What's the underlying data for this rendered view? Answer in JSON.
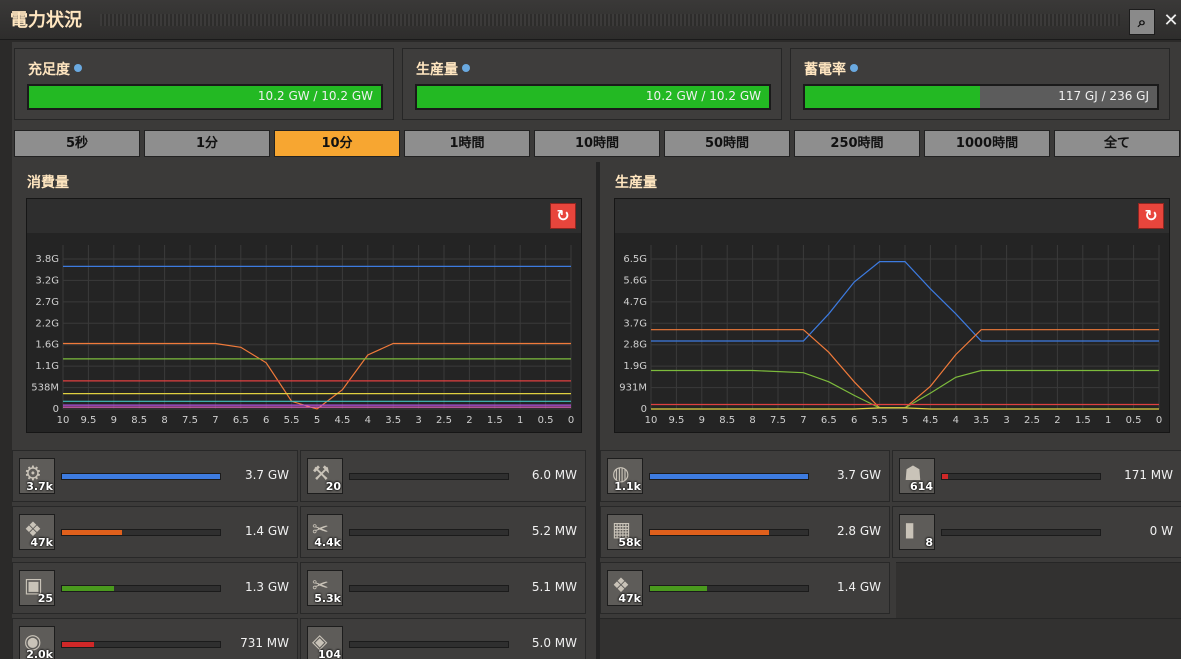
{
  "window": {
    "title": "電力状況"
  },
  "stats": [
    {
      "label": "充足度",
      "value_text": "10.2 GW / 10.2 GW",
      "fill": 1.0
    },
    {
      "label": "生産量",
      "value_text": "10.2 GW / 10.2 GW",
      "fill": 1.0
    },
    {
      "label": "蓄電率",
      "value_text": "117 GJ / 236 GJ",
      "fill": 0.496
    }
  ],
  "tabs": [
    "5秒",
    "1分",
    "10分",
    "1時間",
    "10時間",
    "50時間",
    "250時間",
    "1000時間",
    "全て"
  ],
  "active_tab": 2,
  "colors": {
    "bar_green": "#23b923",
    "tab_active": "#f7a631",
    "reset": "#e8453c"
  },
  "chart_data": [
    {
      "type": "line",
      "title": "消費量",
      "x_ticks": [
        "10",
        "9.5",
        "9",
        "8.5",
        "8",
        "7.5",
        "7",
        "6.5",
        "6",
        "5.5",
        "5",
        "4.5",
        "4",
        "3.5",
        "3",
        "2.5",
        "2",
        "1.5",
        "1",
        "0.5",
        "0"
      ],
      "y_ticks": [
        "0",
        "538M",
        "1.1G",
        "1.6G",
        "2.2G",
        "2.7G",
        "3.2G",
        "3.8G"
      ],
      "x": [
        10,
        9,
        8,
        7,
        6.5,
        6,
        5.5,
        5,
        4.5,
        4,
        3.5,
        3,
        2,
        1,
        0
      ],
      "ylim": [
        0,
        4.0
      ],
      "series": [
        {
          "color": "#3d7be0",
          "values": [
            3.7,
            3.7,
            3.7,
            3.7,
            3.7,
            3.7,
            3.7,
            3.7,
            3.7,
            3.7,
            3.7,
            3.7,
            3.7,
            3.7,
            3.7
          ]
        },
        {
          "color": "#f07a3a",
          "values": [
            1.7,
            1.7,
            1.7,
            1.7,
            1.6,
            1.2,
            0.2,
            0.0,
            0.5,
            1.4,
            1.7,
            1.7,
            1.7,
            1.7,
            1.7
          ]
        },
        {
          "color": "#7dbb3c",
          "values": [
            1.3,
            1.3,
            1.3,
            1.3,
            1.3,
            1.3,
            1.3,
            1.3,
            1.3,
            1.3,
            1.3,
            1.3,
            1.3,
            1.3,
            1.3
          ]
        },
        {
          "color": "#e04040",
          "values": [
            0.73,
            0.73,
            0.73,
            0.73,
            0.73,
            0.73,
            0.73,
            0.73,
            0.73,
            0.73,
            0.73,
            0.73,
            0.73,
            0.73,
            0.73
          ]
        },
        {
          "color": "#e0d040",
          "values": [
            0.4,
            0.4,
            0.4,
            0.4,
            0.4,
            0.4,
            0.4,
            0.4,
            0.4,
            0.4,
            0.4,
            0.4,
            0.4,
            0.4,
            0.4
          ]
        },
        {
          "color": "#b050e0",
          "values": [
            0.1,
            0.1,
            0.1,
            0.1,
            0.1,
            0.1,
            0.1,
            0.1,
            0.1,
            0.1,
            0.1,
            0.1,
            0.1,
            0.1,
            0.1
          ]
        },
        {
          "color": "#e060c0",
          "values": [
            0.05,
            0.05,
            0.05,
            0.05,
            0.05,
            0.05,
            0.05,
            0.05,
            0.05,
            0.05,
            0.05,
            0.05,
            0.05,
            0.05,
            0.05
          ]
        },
        {
          "color": "#40c0c0",
          "values": [
            0.2,
            0.2,
            0.2,
            0.2,
            0.2,
            0.2,
            0.2,
            0.2,
            0.2,
            0.2,
            0.2,
            0.2,
            0.2,
            0.2,
            0.2
          ]
        }
      ]
    },
    {
      "type": "line",
      "title": "生産量",
      "x_ticks": [
        "10",
        "9.5",
        "9",
        "8.5",
        "8",
        "7.5",
        "7",
        "6.5",
        "6",
        "5.5",
        "5",
        "4.5",
        "4",
        "3.5",
        "3",
        "2.5",
        "2",
        "1.5",
        "1",
        "0.5",
        "0"
      ],
      "y_ticks": [
        "0",
        "931M",
        "1.9G",
        "2.8G",
        "3.7G",
        "4.7G",
        "5.6G",
        "6.5G"
      ],
      "x": [
        10,
        9,
        8,
        7,
        6.5,
        6,
        5.5,
        5,
        4.5,
        4,
        3.5,
        3,
        2,
        1,
        0
      ],
      "ylim": [
        0,
        6.8
      ],
      "series": [
        {
          "color": "#3d7be0",
          "values": [
            3.0,
            3.0,
            3.0,
            3.0,
            4.2,
            5.6,
            6.5,
            6.5,
            5.3,
            4.2,
            3.0,
            3.0,
            3.0,
            3.0,
            3.0
          ]
        },
        {
          "color": "#f07a3a",
          "values": [
            3.5,
            3.5,
            3.5,
            3.5,
            2.5,
            1.2,
            0.05,
            0.05,
            1.0,
            2.4,
            3.5,
            3.5,
            3.5,
            3.5,
            3.5
          ]
        },
        {
          "color": "#7dbb3c",
          "values": [
            1.7,
            1.7,
            1.7,
            1.6,
            1.2,
            0.6,
            0.05,
            0.05,
            0.7,
            1.4,
            1.7,
            1.7,
            1.7,
            1.7,
            1.7
          ]
        },
        {
          "color": "#e04040",
          "values": [
            0.2,
            0.2,
            0.2,
            0.2,
            0.2,
            0.2,
            0.2,
            0.2,
            0.2,
            0.2,
            0.2,
            0.2,
            0.2,
            0.2,
            0.2
          ]
        },
        {
          "color": "#e0d040",
          "values": [
            0.0,
            0.0,
            0.0,
            0.0,
            0.0,
            0.0,
            0.05,
            0.05,
            0.0,
            0.0,
            0.0,
            0.0,
            0.0,
            0.0,
            0.0
          ]
        }
      ]
    }
  ],
  "consumers": [
    {
      "icon": "assembler-icon",
      "glyph": "⚙",
      "count": "3.7k",
      "value": "3.7 GW",
      "fill": 1.0,
      "color": "#3d7be0"
    },
    {
      "icon": "roboport-icon",
      "glyph": "⚒",
      "count": "20",
      "value": "6.0 MW",
      "fill": 0.0,
      "color": "#7a7a7a"
    },
    {
      "icon": "lab-icon",
      "glyph": "❖",
      "count": "47k",
      "value": "1.4 GW",
      "fill": 0.38,
      "color": "#e0601c"
    },
    {
      "icon": "inserter-icon",
      "glyph": "✂",
      "count": "4.4k",
      "value": "5.2 MW",
      "fill": 0.0,
      "color": "#7a7a7a"
    },
    {
      "icon": "furnace-icon",
      "glyph": "▣",
      "count": "25",
      "value": "1.3 GW",
      "fill": 0.33,
      "color": "#4a9a1e"
    },
    {
      "icon": "fast-inserter-icon",
      "glyph": "✂",
      "count": "5.3k",
      "value": "5.1 MW",
      "fill": 0.0,
      "color": "#7a7a7a"
    },
    {
      "icon": "beacon-icon",
      "glyph": "◉",
      "count": "2.0k",
      "value": "731 MW",
      "fill": 0.2,
      "color": "#d02828"
    },
    {
      "icon": "radar-icon",
      "glyph": "◈",
      "count": "104",
      "value": "5.0 MW",
      "fill": 0.0,
      "color": "#7a7a7a"
    }
  ],
  "producers": [
    {
      "icon": "steam-engine-icon",
      "glyph": "◍",
      "count": "1.1k",
      "value": "3.7 GW",
      "fill": 1.0,
      "color": "#3d7be0"
    },
    {
      "icon": "steam-turbine-icon",
      "glyph": "☗",
      "count": "614",
      "value": "171 MW",
      "fill": 0.04,
      "color": "#d02828"
    },
    {
      "icon": "solar-panel-icon",
      "glyph": "▦",
      "count": "58k",
      "value": "2.8 GW",
      "fill": 0.75,
      "color": "#e0601c"
    },
    {
      "icon": "generator-icon",
      "glyph": "▮",
      "count": "8",
      "value": "0 W",
      "fill": 0.0,
      "color": "#7a7a7a"
    },
    {
      "icon": "accumulator-icon",
      "glyph": "❖",
      "count": "47k",
      "value": "1.4 GW",
      "fill": 0.36,
      "color": "#4a9a1e"
    }
  ]
}
